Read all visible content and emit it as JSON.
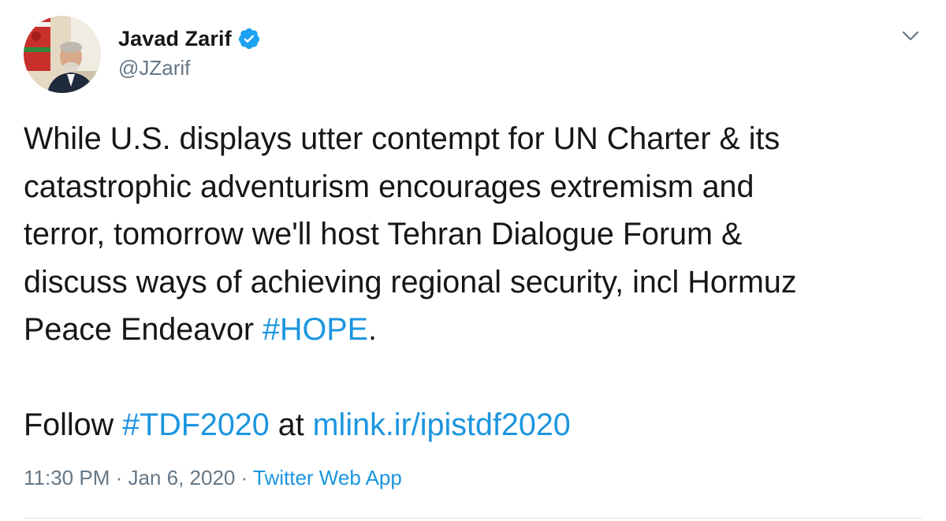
{
  "author": {
    "display_name": "Javad Zarif",
    "handle": "@JZarif",
    "avatar_icon": "profile-photo",
    "verified_icon": "verified-badge-icon"
  },
  "menu": {
    "caret_icon": "chevron-down-icon"
  },
  "tweet": {
    "lines": [
      "While U.S. displays utter contempt for UN Charter & its",
      "catastrophic adventurism encourages extremism and",
      "terror, tomorrow we'll host Tehran Dialogue Forum &",
      "discuss ways of achieving regional security, incl Hormuz"
    ],
    "line5_text": "Peace Endeavor ",
    "hashtag_hope": "#HOPE",
    "line5_end": ".",
    "follow_text": "Follow ",
    "hashtag_tdf": "#TDF2020",
    "at_text": " at ",
    "link_text": "mlink.ir/ipistdf2020"
  },
  "meta": {
    "time": "11:30 PM",
    "sep1": " · ",
    "date": "Jan 6, 2020",
    "sep2": " · ",
    "source": "Twitter Web App"
  },
  "colors": {
    "text": "#14171a",
    "secondary": "#657786",
    "link": "#1b95e0",
    "verified": "#1da1f2",
    "divider": "#e1e8ed"
  }
}
